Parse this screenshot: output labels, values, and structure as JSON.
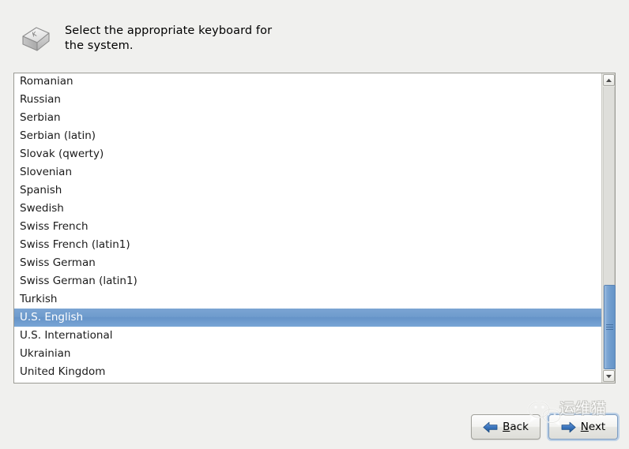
{
  "header": {
    "icon": "keyboard-key-icon",
    "instruction": "Select the appropriate keyboard for the system.",
    "instruction_line1": "Select the appropriate keyboard for",
    "instruction_line2": "the system."
  },
  "keyboard_list": {
    "name": "keyboard-layout-list",
    "selected": "U.S. English",
    "items": [
      {
        "label": "Romanian",
        "selected": false
      },
      {
        "label": "Russian",
        "selected": false
      },
      {
        "label": "Serbian",
        "selected": false
      },
      {
        "label": "Serbian (latin)",
        "selected": false
      },
      {
        "label": "Slovak (qwerty)",
        "selected": false
      },
      {
        "label": "Slovenian",
        "selected": false
      },
      {
        "label": "Spanish",
        "selected": false
      },
      {
        "label": "Swedish",
        "selected": false
      },
      {
        "label": "Swiss French",
        "selected": false
      },
      {
        "label": "Swiss French (latin1)",
        "selected": false
      },
      {
        "label": "Swiss German",
        "selected": false
      },
      {
        "label": "Swiss German (latin1)",
        "selected": false
      },
      {
        "label": "Turkish",
        "selected": false
      },
      {
        "label": "U.S. English",
        "selected": true
      },
      {
        "label": "U.S. International",
        "selected": false
      },
      {
        "label": "Ukrainian",
        "selected": false
      },
      {
        "label": "United Kingdom",
        "selected": false
      }
    ]
  },
  "scrollbar": {
    "up_arrow_icon": "chevron-up-icon",
    "down_arrow_icon": "chevron-down-icon",
    "thumb_top_pct": 70,
    "thumb_height_pct": 30
  },
  "buttons": {
    "back": {
      "label": "Back",
      "accel": "B",
      "icon": "arrow-left-icon",
      "focused": false
    },
    "next": {
      "label": "Next",
      "accel": "N",
      "icon": "arrow-right-icon",
      "focused": true
    }
  },
  "watermark": {
    "text": "运维猫",
    "logo": "wechat-logo-icon"
  },
  "colors": {
    "background": "#f0f0ee",
    "list_background": "#ffffff",
    "selection_blue": "#6f9ccd",
    "border_gray": "#9a9a94",
    "arrow_blue": "#2f6cb5",
    "text": "#1b1b1b"
  }
}
